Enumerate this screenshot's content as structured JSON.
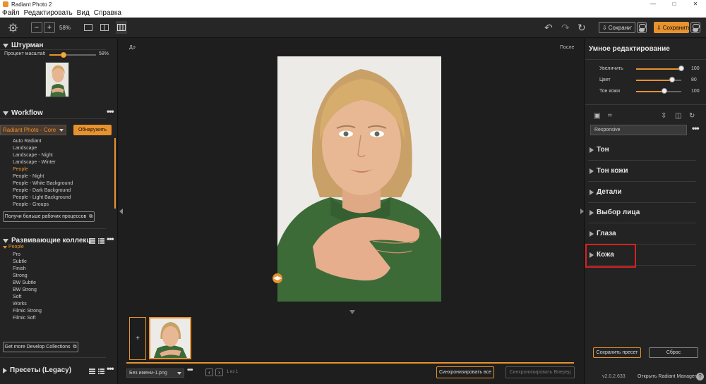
{
  "window": {
    "title": "Radiant Photo 2",
    "controls": [
      "—",
      "□",
      "✕"
    ]
  },
  "menu": [
    "Файл",
    "Редактировать",
    "Вид",
    "Справка"
  ],
  "toolbar": {
    "zoom": "58%",
    "minus": "−",
    "plus": "+",
    "save_all": "Сохранить Все",
    "save": "Сохранить"
  },
  "navigator": {
    "title": "Штурман",
    "scale_label": "Процент масштабирования",
    "scale_value": "58%",
    "scale_fraction": 0.3
  },
  "workflow": {
    "title": "Workflow",
    "selected_workflow": "Radiant Photo - Core",
    "detect_button": "Обнаружить",
    "items": [
      "Auto Radiant",
      "Landscape",
      "Landscape - Night",
      "Landscape - Winter",
      "People",
      "People - Night",
      "People - White Background",
      "People - Dark Background",
      "People - Light Background",
      "People - Groups"
    ],
    "selected_index": 4,
    "more_button": "Получи больше рабочих процессов"
  },
  "collections": {
    "title": "Развивающие коллекции",
    "group": "People",
    "items": [
      "Pro",
      "Subtle",
      "Finish",
      "Strong",
      "BW Subtle",
      "BW Strong",
      "Soft",
      "Works",
      "Filmic Strong",
      "Filmic Soft"
    ],
    "more_button": "Get more Develop Collections"
  },
  "presets_legacy": {
    "title": "Пресеты (Legacy)"
  },
  "canvas": {
    "before_label": "До",
    "after_label": "После",
    "file_name": "Без имени-1.png",
    "page_indicator": "1 из 1",
    "sync_all": "Синхронизировать все",
    "sync_forward": "Синхронизировать Вперед"
  },
  "smart_edit": {
    "title": "Умное редактирование",
    "sliders": [
      {
        "label": "Увеличить",
        "value": "100",
        "fraction": 1.0
      },
      {
        "label": "Цвет",
        "value": "80",
        "fraction": 0.8
      },
      {
        "label": "Тон кожи",
        "value": "100",
        "fraction": 0.63
      }
    ],
    "preset_value": "Responsive",
    "sections": [
      "Тон",
      "Тон кожи",
      "Детали",
      "Выбор лица",
      "Глаза",
      "Кожа"
    ],
    "highlighted_section": "Кожа",
    "save_preset": "Сохранить пресет",
    "reset": "Сброс",
    "version": "v2.0.2.633",
    "open_manager": "Открыть Radiant Manager"
  },
  "colors": {
    "accent": "#e8922e",
    "highlight": "#d82020"
  }
}
